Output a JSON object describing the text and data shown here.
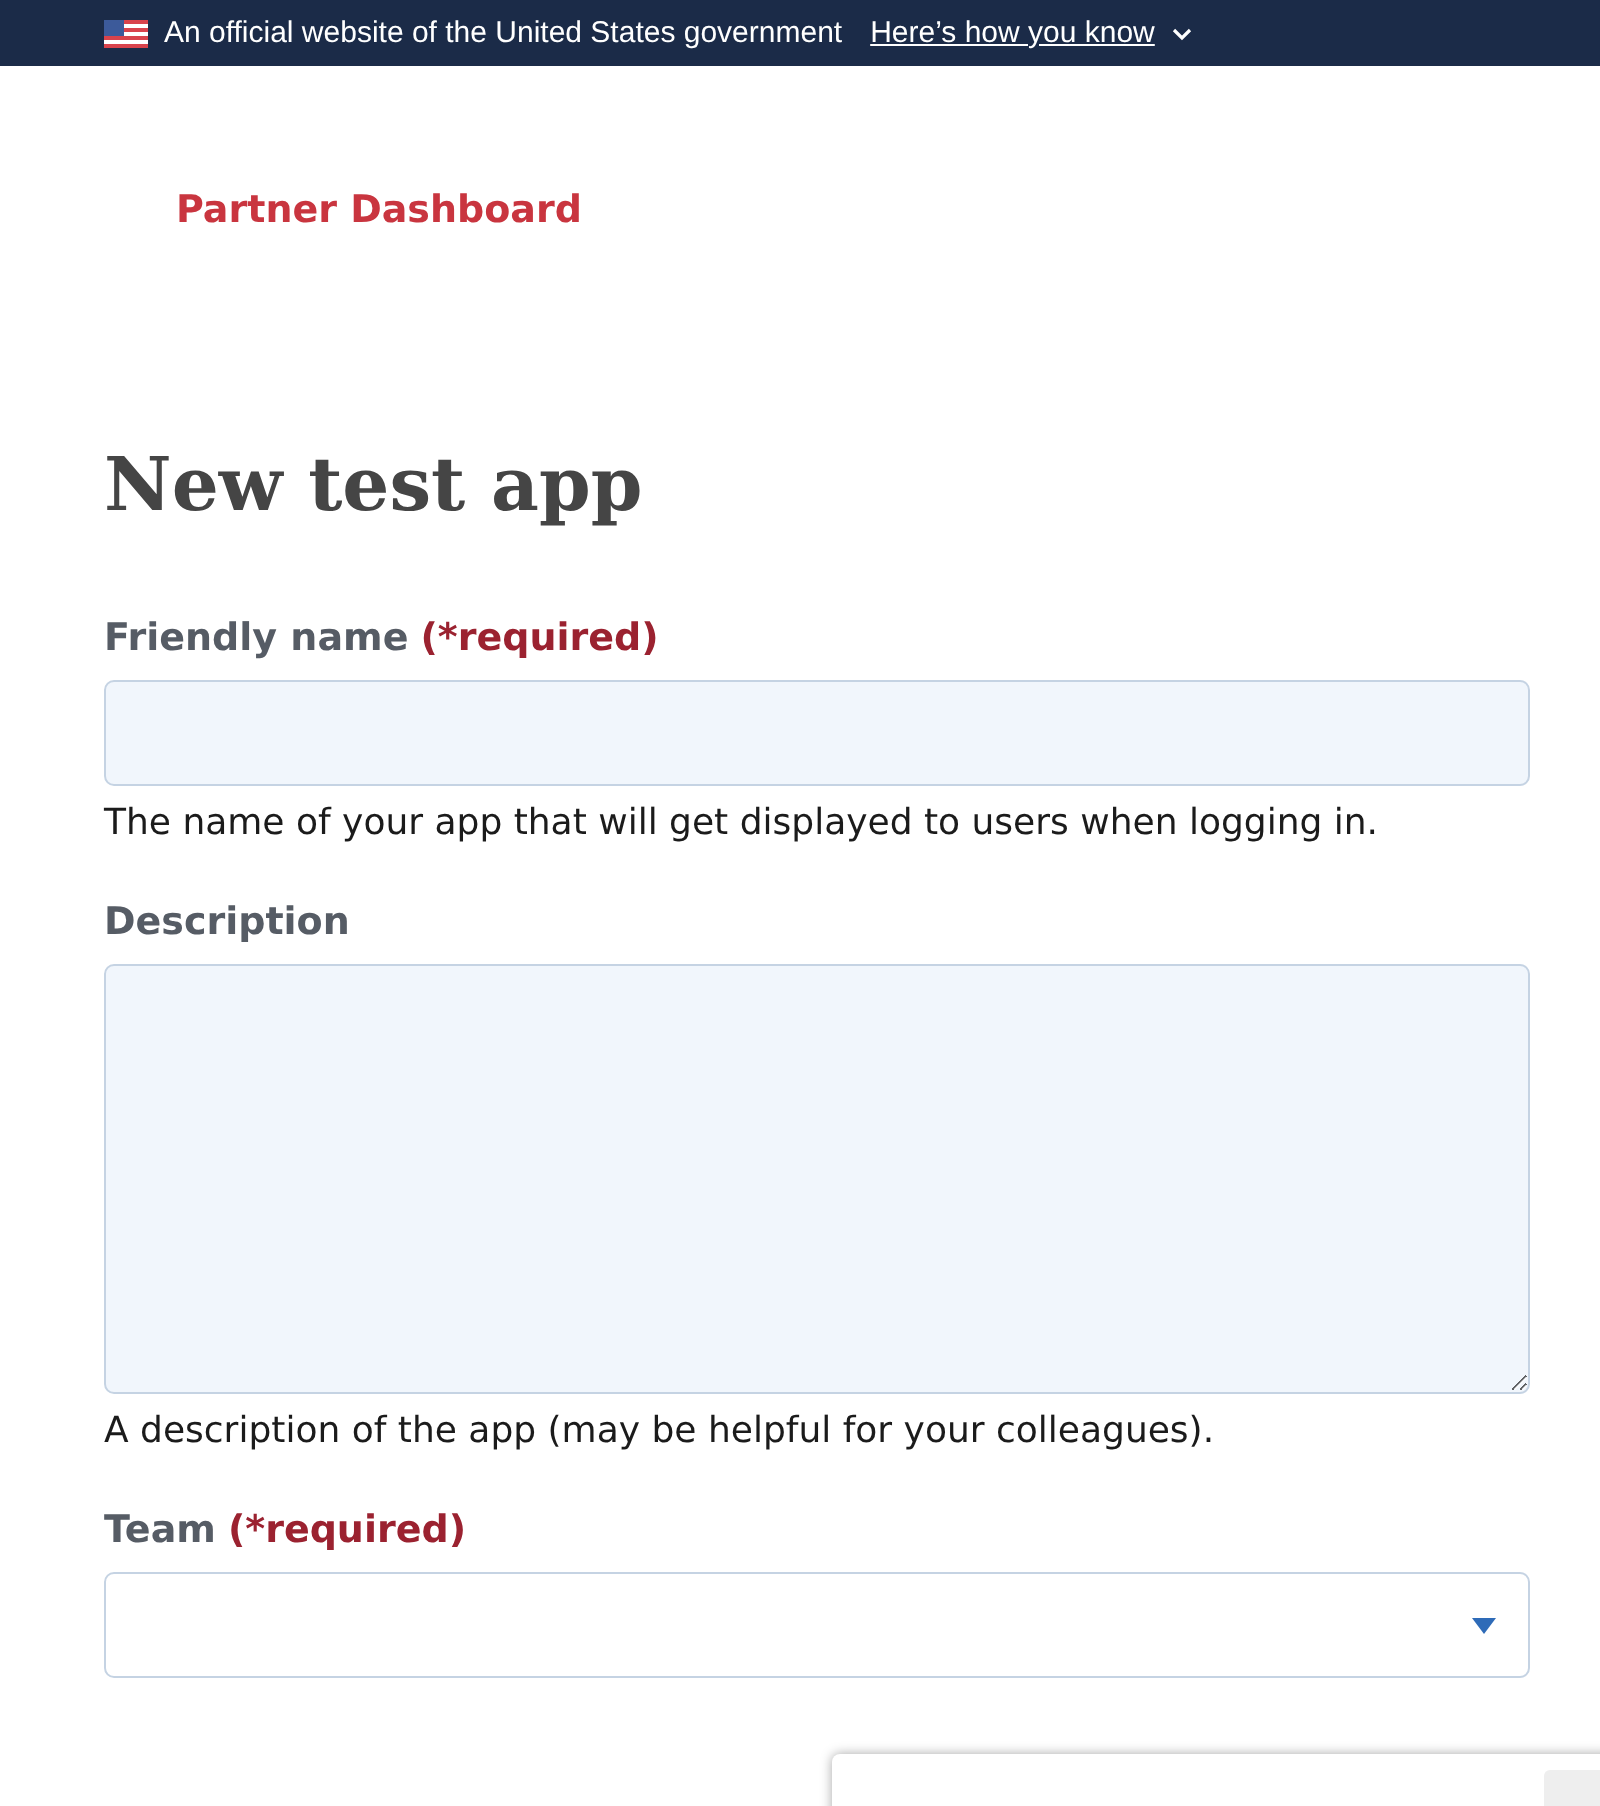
{
  "banner": {
    "text": "An official website of the United States government",
    "link": "Here’s how you know"
  },
  "header": {
    "title": "Partner Dashboard"
  },
  "page_title": "New test app",
  "fields": [
    {
      "kind": "input",
      "label": "Friendly name",
      "required": "(*required)",
      "hint": "The name of your app that will get displayed to users when logging in."
    },
    {
      "kind": "textarea",
      "label": "Description",
      "hint": "A description of the app (may be helpful for your colleagues)."
    },
    {
      "kind": "select",
      "label": "Team",
      "required": "(*required)"
    }
  ]
}
